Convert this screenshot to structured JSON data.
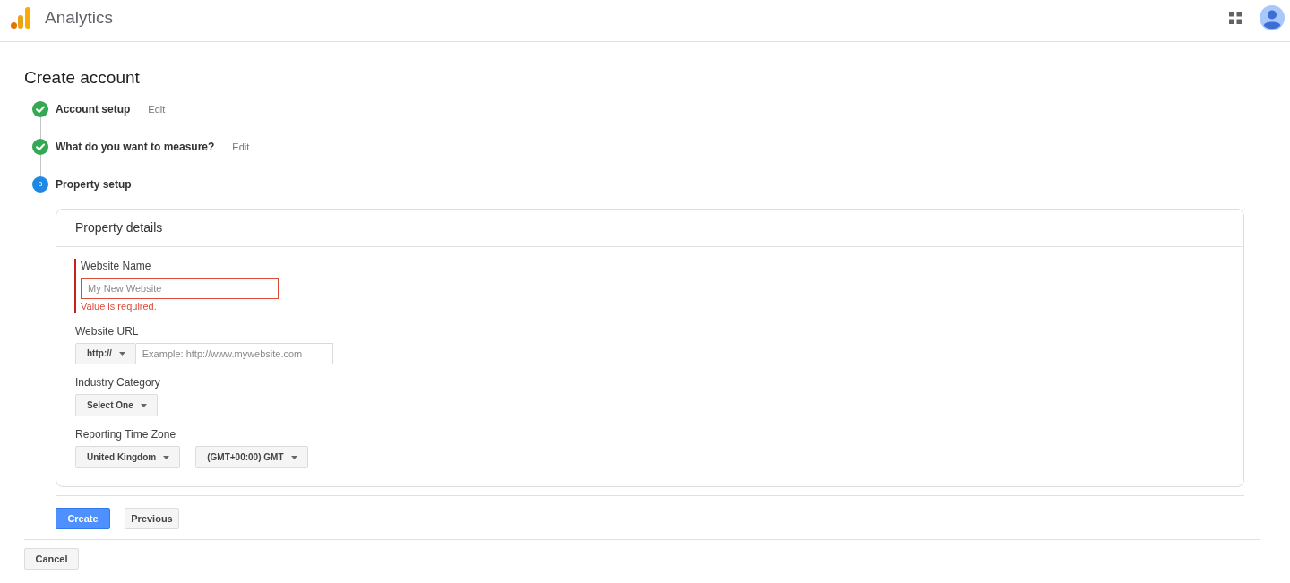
{
  "app_bar": {
    "title": "Analytics"
  },
  "page_title": "Create account",
  "steps": [
    {
      "label": "Account setup",
      "completed": true,
      "edit": "Edit"
    },
    {
      "label": "What do you want to measure?",
      "completed": true,
      "edit": "Edit"
    },
    {
      "label": "Property setup",
      "completed": false,
      "number": "3"
    }
  ],
  "property_details": {
    "title": "Property details",
    "fields": [
      {
        "kind": "text",
        "label": "Website Name",
        "placeholder": "My New Website",
        "error": "Value is required."
      },
      {
        "kind": "url",
        "label": "Website URL",
        "dropdowns": [
          "http://"
        ],
        "placeholder": "Example: http://www.mywebsite.com"
      },
      {
        "kind": "select",
        "label": "Industry Category",
        "dropdowns": [
          "Select One"
        ]
      },
      {
        "kind": "select",
        "label": "Reporting Time Zone",
        "dropdowns": [
          "United Kingdom",
          "(GMT+00:00) GMT"
        ]
      }
    ]
  },
  "actions": [
    {
      "label": "Create",
      "kind": "primary"
    },
    {
      "label": "Previous",
      "kind": "secondary"
    }
  ],
  "cancel": {
    "label": "Cancel"
  }
}
